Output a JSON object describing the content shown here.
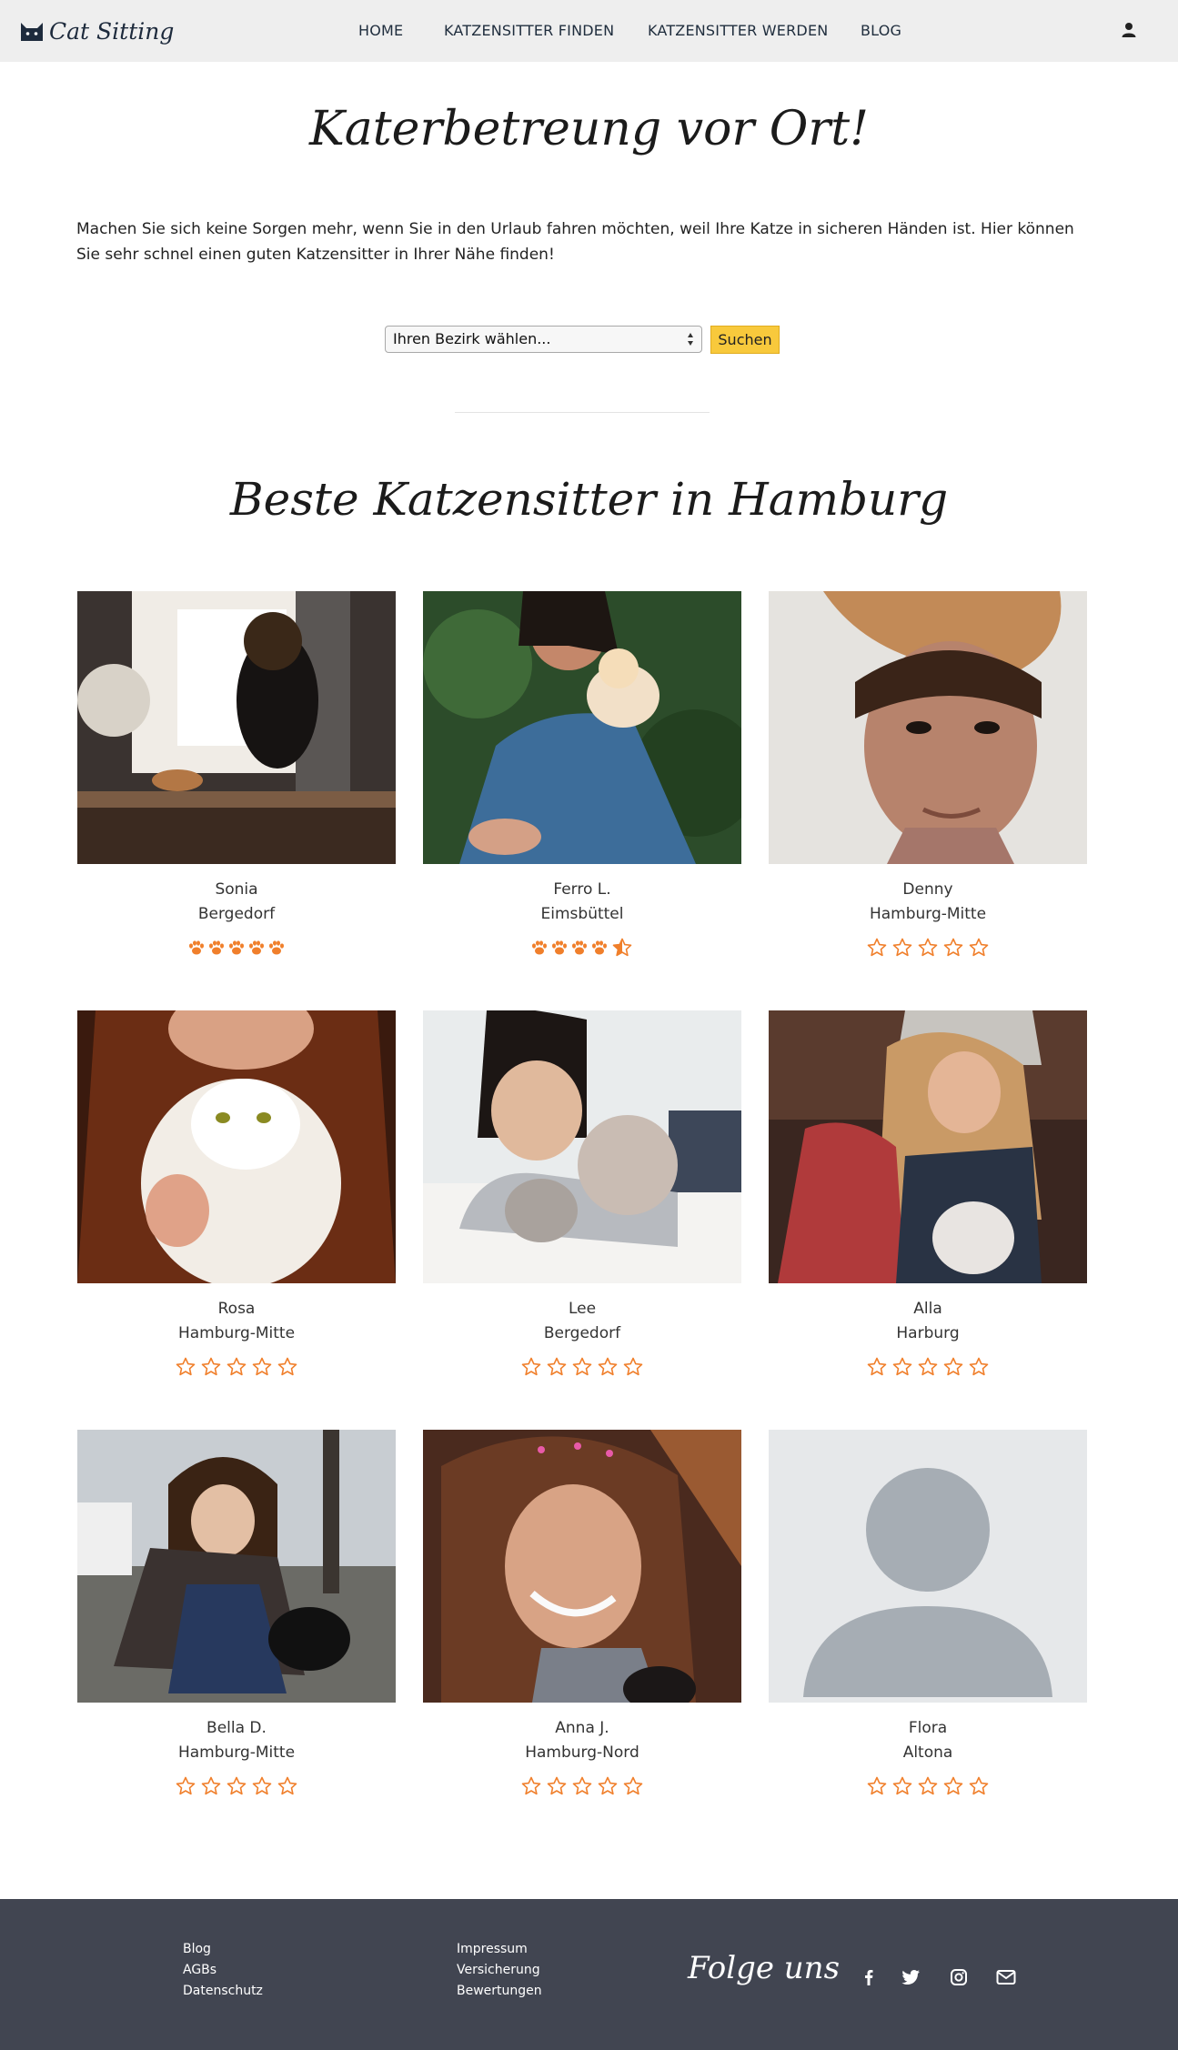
{
  "brand": {
    "name": "Cat Sitting",
    "icon": "cat-logo-icon"
  },
  "nav": {
    "items": [
      {
        "label": "HOME"
      },
      {
        "label": "KATZENSITTER FINDEN"
      },
      {
        "label": "KATZENSITTER WERDEN"
      },
      {
        "label": "BLOG"
      }
    ],
    "user_icon": "user-icon"
  },
  "hero": {
    "title": "Katerbetreung vor Ort!",
    "intro": "Machen Sie sich keine Sorgen mehr, wenn Sie in den Urlaub fahren möchten, weil Ihre Katze in sicheren Händen ist. Hier können Sie sehr schnel einen guten Katzensitter in Ihrer Nähe finden!"
  },
  "search": {
    "select_value": "Ihren Bezirk wählen...",
    "button_label": "Suchen"
  },
  "section": {
    "title": "Beste Katzensitter in Hamburg"
  },
  "colors": {
    "accent": "#f8c93c",
    "star": "#f07f2b",
    "footer": "#414551",
    "nav": "#eeeeee"
  },
  "sitters": [
    {
      "name": "Sonia",
      "location": "Bergedorf",
      "rating": 5,
      "rating_style": "paws"
    },
    {
      "name": "Ferro L.",
      "location": "Eimsbüttel",
      "rating": 4.5,
      "rating_style": "paws"
    },
    {
      "name": "Denny",
      "location": "Hamburg-Mitte",
      "rating": 0,
      "rating_style": "stars"
    },
    {
      "name": "Rosa",
      "location": "Hamburg-Mitte",
      "rating": 0,
      "rating_style": "stars"
    },
    {
      "name": "Lee",
      "location": "Bergedorf",
      "rating": 0,
      "rating_style": "stars"
    },
    {
      "name": "Alla",
      "location": "Harburg",
      "rating": 0,
      "rating_style": "stars"
    },
    {
      "name": "Bella D.",
      "location": "Hamburg-Mitte",
      "rating": 0,
      "rating_style": "stars"
    },
    {
      "name": "Anna J.",
      "location": "Hamburg-Nord",
      "rating": 0,
      "rating_style": "stars"
    },
    {
      "name": "Flora",
      "location": "Altona",
      "rating": 0,
      "rating_style": "stars"
    }
  ],
  "footer": {
    "col1": [
      "Blog",
      "AGBs",
      "Datenschutz"
    ],
    "col2": [
      "Impressum",
      "Versicherung",
      "Bewertungen"
    ],
    "follow": "Folge uns",
    "social": [
      "facebook-icon",
      "twitter-icon",
      "instagram-icon",
      "mail-icon"
    ]
  }
}
